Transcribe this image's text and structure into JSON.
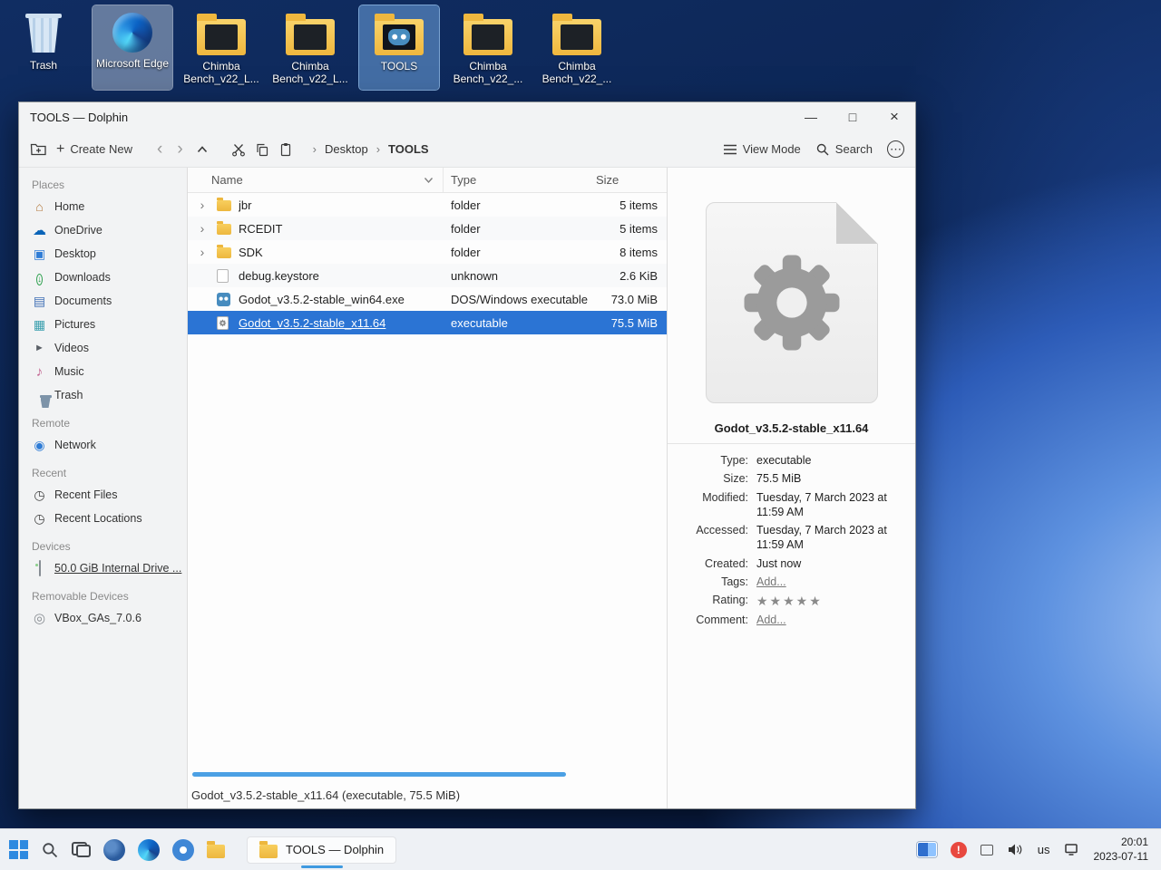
{
  "desktop": {
    "icons": [
      {
        "label": "Trash"
      },
      {
        "label": "Microsoft Edge"
      },
      {
        "label": "Chimba Bench_v22_L..."
      },
      {
        "label": "Chimba Bench_v22_L..."
      },
      {
        "label": "TOOLS"
      },
      {
        "label": "Chimba Bench_v22_..."
      },
      {
        "label": "Chimba Bench_v22_..."
      }
    ]
  },
  "window": {
    "title": "TOOLS — Dolphin",
    "toolbar": {
      "create_new": "Create New",
      "view_mode": "View Mode",
      "search": "Search"
    },
    "breadcrumb": [
      "Desktop",
      "TOOLS"
    ]
  },
  "sidebar": {
    "sections": [
      {
        "title": "Places",
        "items": [
          "Home",
          "OneDrive",
          "Desktop",
          "Downloads",
          "Documents",
          "Pictures",
          "Videos",
          "Music",
          "Trash"
        ]
      },
      {
        "title": "Remote",
        "items": [
          "Network"
        ]
      },
      {
        "title": "Recent",
        "items": [
          "Recent Files",
          "Recent Locations"
        ]
      },
      {
        "title": "Devices",
        "items": [
          "50.0 GiB Internal Drive ..."
        ]
      },
      {
        "title": "Removable Devices",
        "items": [
          "VBox_GAs_7.0.6"
        ]
      }
    ]
  },
  "filelist": {
    "columns": [
      "Name",
      "Type",
      "Size"
    ],
    "rows": [
      {
        "name": "jbr",
        "type": "folder",
        "size": "5 items"
      },
      {
        "name": "RCEDIT",
        "type": "folder",
        "size": "5 items"
      },
      {
        "name": "SDK",
        "type": "folder",
        "size": "8 items"
      },
      {
        "name": "debug.keystore",
        "type": "unknown",
        "size": "2.6 KiB"
      },
      {
        "name": "Godot_v3.5.2-stable_win64.exe",
        "type": "DOS/Windows executable",
        "size": "73.0 MiB"
      },
      {
        "name": "Godot_v3.5.2-stable_x11.64",
        "type": "executable",
        "size": "75.5 MiB"
      }
    ]
  },
  "info_panel": {
    "filename": "Godot_v3.5.2-stable_x11.64",
    "details": [
      {
        "label": "Type:",
        "value": "executable"
      },
      {
        "label": "Size:",
        "value": "75.5 MiB"
      },
      {
        "label": "Modified:",
        "value": "Tuesday, 7 March 2023 at 11:59 AM"
      },
      {
        "label": "Accessed:",
        "value": "Tuesday, 7 March 2023 at 11:59 AM"
      },
      {
        "label": "Created:",
        "value": "Just now"
      },
      {
        "label": "Tags:",
        "value": "Add..."
      },
      {
        "label": "Rating:",
        "value": "★★★★★"
      },
      {
        "label": "Comment:",
        "value": "Add..."
      }
    ]
  },
  "statusbar": {
    "text": "Godot_v3.5.2-stable_x11.64 (executable, 75.5 MiB)"
  },
  "taskbar": {
    "app_button": "TOOLS — Dolphin",
    "keyboard_layout": "us",
    "clock_time": "20:01",
    "clock_date": "2023-07-11"
  },
  "icons": {
    "minimize": "—",
    "maximize": "□",
    "close": "×",
    "plus": "+",
    "back": "‹",
    "forward": "›",
    "crumb": "›",
    "expander": "›",
    "overflow": "⋯",
    "home": "⌂",
    "cloud": "☁",
    "screen": "▣",
    "down_arrow": "↓",
    "document": "▤",
    "picture": "▦",
    "play": "►",
    "note": "♪",
    "circle": "◉",
    "clock": "◷",
    "disc": "◎",
    "alert": "!"
  }
}
